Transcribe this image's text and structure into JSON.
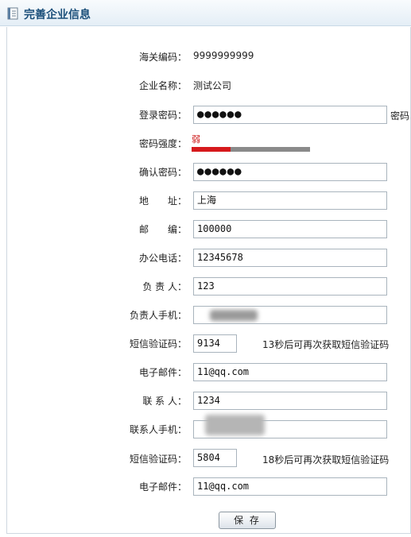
{
  "page": {
    "title": "完善企业信息"
  },
  "form": {
    "customs_code": {
      "label": "海关编码：",
      "value": "9999999999"
    },
    "company_name": {
      "label": "企业名称：",
      "value": "测试公司"
    },
    "login_password": {
      "label": "登录密码：",
      "value": "●●●●●●",
      "suffix": "密码"
    },
    "password_strength": {
      "label": "密码强度：",
      "text": "弱",
      "level": 0.33
    },
    "confirm_password": {
      "label": "确认密码：",
      "value": "●●●●●●"
    },
    "address": {
      "label": "地　　址：",
      "value": "上海"
    },
    "postcode": {
      "label": "邮　　编：",
      "value": "100000"
    },
    "office_phone": {
      "label": "办公电话：",
      "value": "12345678"
    },
    "responsible_person": {
      "label": "负 责 人：",
      "value": "123"
    },
    "responsible_mobile": {
      "label": "负责人手机："
    },
    "sms_code_1": {
      "label": "短信验证码：",
      "value": "9134",
      "note": "13秒后可再次获取短信验证码"
    },
    "email_1": {
      "label": "电子邮件：",
      "value": "11@qq.com"
    },
    "contact_person": {
      "label": "联 系 人：",
      "value": "1234"
    },
    "contact_mobile": {
      "label": "联系人手机："
    },
    "sms_code_2": {
      "label": "短信验证码：",
      "value": "5804",
      "note": "18秒后可再次获取短信验证码"
    },
    "email_2": {
      "label": "电子邮件：",
      "value": "11@qq.com"
    },
    "save_label": "保 存"
  },
  "colors": {
    "title": "#1b4f7a",
    "strength_weak": "#d6191c",
    "strength_track": "#8a8a8a"
  },
  "icons": {
    "title": "document-icon"
  }
}
